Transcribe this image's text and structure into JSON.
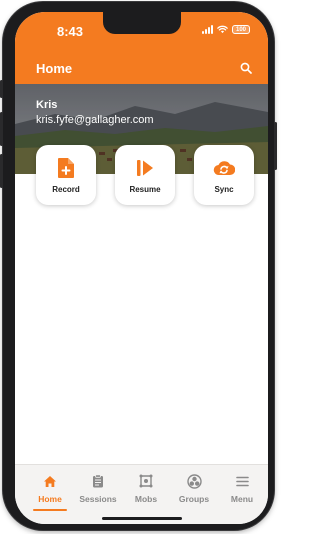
{
  "status_bar": {
    "time": "8:43",
    "battery": "100"
  },
  "header": {
    "title": "Home",
    "search_icon": "search-icon"
  },
  "profile": {
    "name": "Kris",
    "email": "kris.fyfe@gallagher.com"
  },
  "actions": [
    {
      "label": "Record",
      "icon": "add-document-icon"
    },
    {
      "label": "Resume",
      "icon": "resume-icon"
    },
    {
      "label": "Sync",
      "icon": "cloud-sync-icon"
    }
  ],
  "tabs": [
    {
      "label": "Home",
      "icon": "home-icon",
      "active": true
    },
    {
      "label": "Sessions",
      "icon": "clipboard-icon",
      "active": false
    },
    {
      "label": "Mobs",
      "icon": "mobs-icon",
      "active": false
    },
    {
      "label": "Groups",
      "icon": "groups-icon",
      "active": false
    },
    {
      "label": "Menu",
      "icon": "hamburger-menu-icon",
      "active": false
    }
  ],
  "colors": {
    "accent": "#f47b20",
    "tab_inactive": "#8a8a8a",
    "tab_bar_bg": "#f4f3f2"
  }
}
